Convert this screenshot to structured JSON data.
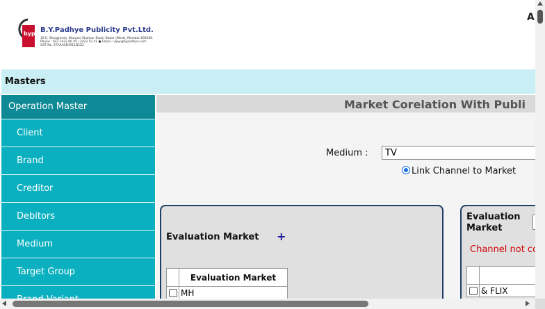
{
  "header": {
    "logo": {
      "company": "B.Y.Padhye Publicity Pvt.Ltd.",
      "mark_letters": "byp",
      "address_line": "32-E, Shivganesh, Bhavani Shankar Road, Dadar (West), Mumbai 400028.",
      "contact_line": "Phone : 022 2422 06 45 / 2422 52 41  ●  Email : vijay@bypadhye.com",
      "gst_line": "GST No. 27AAACB1911D1Z2"
    },
    "top_right_text": "A"
  },
  "masters_bar": {
    "label": "Masters"
  },
  "sidebar": {
    "header": "Operation Master",
    "items": [
      {
        "label": "Client"
      },
      {
        "label": "Brand"
      },
      {
        "label": "Creditor"
      },
      {
        "label": "Debitors"
      },
      {
        "label": "Medium"
      },
      {
        "label": "Target Group"
      },
      {
        "label": "Brand Variant"
      }
    ]
  },
  "main": {
    "title": "Market Corelation With Publi",
    "medium": {
      "label": "Medium :",
      "value": "TV"
    },
    "link_option": {
      "label": "Link Channel to Market",
      "checked": true
    },
    "left_panel": {
      "title": "Evaluation Market",
      "add_icon": "+",
      "table": {
        "header": "Evaluation Market",
        "rows": [
          {
            "value": "MH"
          }
        ]
      }
    },
    "right_panel": {
      "title_line1": "Evaluation",
      "title_line2": "Market",
      "message": "Channel not co",
      "rows": [
        {
          "value": "& FLIX"
        }
      ]
    }
  },
  "colors": {
    "sidebar_header": "#0e8a96",
    "sidebar_item": "#0ab0bf",
    "masters_bar": "#c9eef3",
    "panel_border": "#1e3f66",
    "error_text": "#d00000"
  }
}
